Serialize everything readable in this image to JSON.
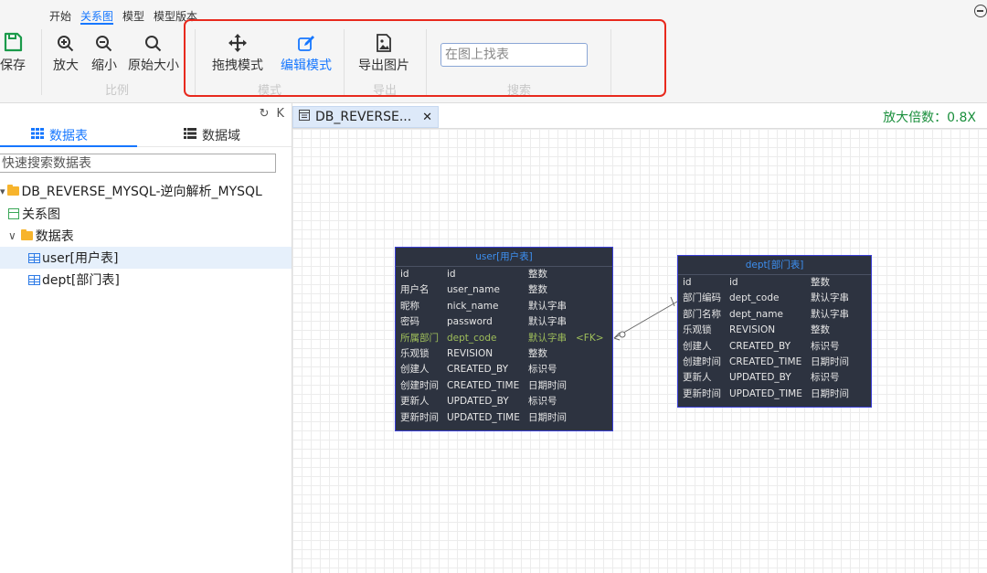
{
  "toolbar": {
    "tabs": [
      "开始",
      "关系图",
      "模型",
      "模型版本"
    ],
    "save": "保存",
    "zoom_in": "放大",
    "zoom_out": "缩小",
    "original_size": "原始大小",
    "group_scale": "比例",
    "drag_mode": "拖拽模式",
    "edit_mode": "编辑模式",
    "group_mode": "模式",
    "export_image": "导出图片",
    "group_export": "导出",
    "find_placeholder": "在图上找表",
    "group_search": "搜索"
  },
  "sidebar": {
    "tools": [
      "↻",
      "K"
    ],
    "tab_tables": "数据表",
    "tab_domains": "数据域",
    "search_placeholder": "快速搜索数据表",
    "tree": {
      "root": "DB_REVERSE_MYSQL-逆向解析_MYSQL",
      "diagram": "关系图",
      "tables_folder": "数据表",
      "tables": [
        "user[用户表]",
        "dept[部门表]"
      ]
    }
  },
  "editor": {
    "tab_title": "DB_REVERSE...",
    "close_glyph": "✕",
    "zoom_label": "放大倍数：0.8X"
  },
  "entities": [
    {
      "title": "user[用户表]",
      "rows": [
        [
          "id",
          "id",
          "整数",
          ""
        ],
        [
          "用户名",
          "user_name",
          "整数",
          ""
        ],
        [
          "昵称",
          "nick_name",
          "默认字串",
          ""
        ],
        [
          "密码",
          "password",
          "默认字串",
          ""
        ],
        [
          "所属部门",
          "dept_code",
          "默认字串",
          "<FK>"
        ],
        [
          "乐观锁",
          "REVISION",
          "整数",
          ""
        ],
        [
          "创建人",
          "CREATED_BY",
          "标识号",
          ""
        ],
        [
          "创建时间",
          "CREATED_TIME",
          "日期时间",
          ""
        ],
        [
          "更新人",
          "UPDATED_BY",
          "标识号",
          ""
        ],
        [
          "更新时间",
          "UPDATED_TIME",
          "日期时间",
          ""
        ]
      ]
    },
    {
      "title": "dept[部门表]",
      "rows": [
        [
          "id",
          "id",
          "整数",
          ""
        ],
        [
          "部门编码",
          "dept_code",
          "默认字串",
          ""
        ],
        [
          "部门名称",
          "dept_name",
          "默认字串",
          ""
        ],
        [
          "乐观锁",
          "REVISION",
          "整数",
          ""
        ],
        [
          "创建人",
          "CREATED_BY",
          "标识号",
          ""
        ],
        [
          "创建时间",
          "CREATED_TIME",
          "日期时间",
          ""
        ],
        [
          "更新人",
          "UPDATED_BY",
          "标识号",
          ""
        ],
        [
          "更新时间",
          "UPDATED_TIME",
          "日期时间",
          ""
        ]
      ]
    }
  ],
  "colors": {
    "accent": "#1677ff",
    "highlight_box": "#e8291d",
    "entity_bg": "#2d3340",
    "entity_border": "#3b3fd8",
    "fk_row": "#9fbf5a",
    "zoom_text": "#1a8f3c"
  }
}
